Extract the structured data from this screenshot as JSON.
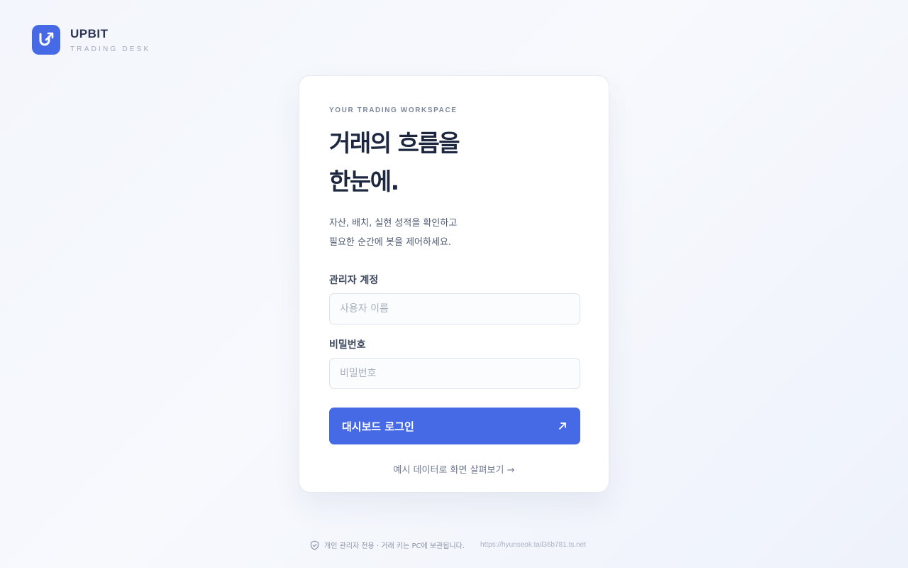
{
  "brand": {
    "name": "UPBIT",
    "subtitle": "TRADING DESK",
    "logo_icon": "arrow-up-right-icon",
    "accent_color": "#4669e6"
  },
  "card": {
    "eyebrow": "YOUR TRADING WORKSPACE",
    "headline_line1": "거래의 흐름을",
    "headline_line2": "한눈에.",
    "desc_line1": "자산, 배치, 실현 성적을 확인하고",
    "desc_line2": "필요한 순간에 봇을 제어하세요."
  },
  "form": {
    "username_label": "관리자 계정",
    "username_placeholder": "사용자 이름",
    "username_value": "",
    "password_label": "비밀번호",
    "password_placeholder": "비밀번호",
    "password_value": "",
    "login_label": "대시보드 로그인",
    "login_icon": "arrow-up-right-icon",
    "demo_link": "예시 데이터로 화면 살펴보기 →"
  },
  "footer": {
    "shield_icon": "shield-check-icon",
    "notice": "개인 관리자 전용 · 거래 키는 PC에 보관됩니다.",
    "url": "https://hyunseok.tail36b781.ts.net"
  }
}
